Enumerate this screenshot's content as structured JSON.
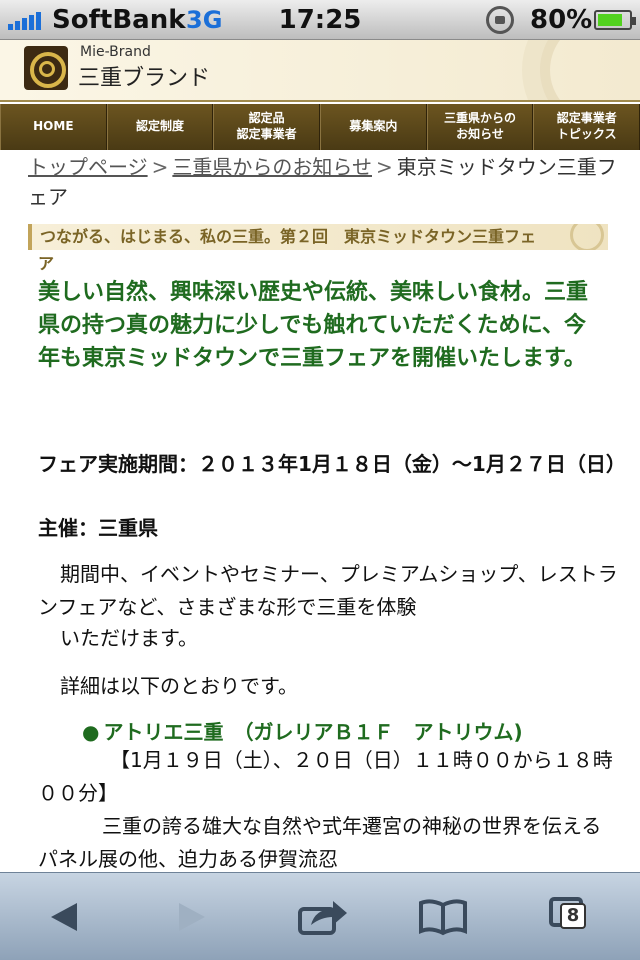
{
  "status_bar": {
    "carrier": "SoftBank",
    "network": "3G",
    "time": "17:25",
    "battery_percent": "80%",
    "battery_level": 0.8
  },
  "header": {
    "brand_en": "Mie-Brand",
    "brand_ja": "三重ブランド"
  },
  "nav": {
    "items": [
      {
        "label": "HOME"
      },
      {
        "label": "認定制度"
      },
      {
        "label": "認定品\n認定事業者"
      },
      {
        "label": "募集案内"
      },
      {
        "label": "三重県からの\nお知らせ"
      },
      {
        "label": "認定事業者\nトピックス"
      }
    ]
  },
  "breadcrumb": {
    "top": "トップページ",
    "sep": ">",
    "notices": "三重県からのお知らせ",
    "current": "東京ミッドタウン三重フェア"
  },
  "article": {
    "title_line1": "つながる、はじまる、私の三重。第２回　東京ミッドタウン三重フェ",
    "title_line2": "ア",
    "lead": "美しい自然、興味深い歴史や伝統、美味しい食材。三重県の持つ真の魅力に少しでも触れていただくために、今年も東京ミッドタウンで三重フェアを開催いたします。",
    "period": "フェア実施期間：２０１３年1月１８日（金）～1月２７日（日）",
    "host": "主催：三重県",
    "para1": "期間中、イベントやセミナー、プレミアムショップ、レストランフェアなど、さまざまな形で三重を体験",
    "para1b": "いただけます。",
    "para2": "詳細は以下のとおりです。",
    "event_title": "アトリエ三重　（ガレリアＢ１Ｆ　アトリウム)",
    "event_bullet": "●",
    "event_date": "【1月１９日（土）、２０日（日）１１時００から１８時００分】",
    "event_desc": "三重の誇る雄大な自然や式年遷宮の神秘の世界を伝えるパネル展の他、迫力ある伊賀流忍"
  },
  "toolbar": {
    "back_icon": "back-arrow-icon",
    "forward_icon": "forward-arrow-icon",
    "share_icon": "share-icon",
    "bookmarks_icon": "book-icon",
    "tabs_icon": "tabs-icon",
    "tab_count": "8"
  }
}
